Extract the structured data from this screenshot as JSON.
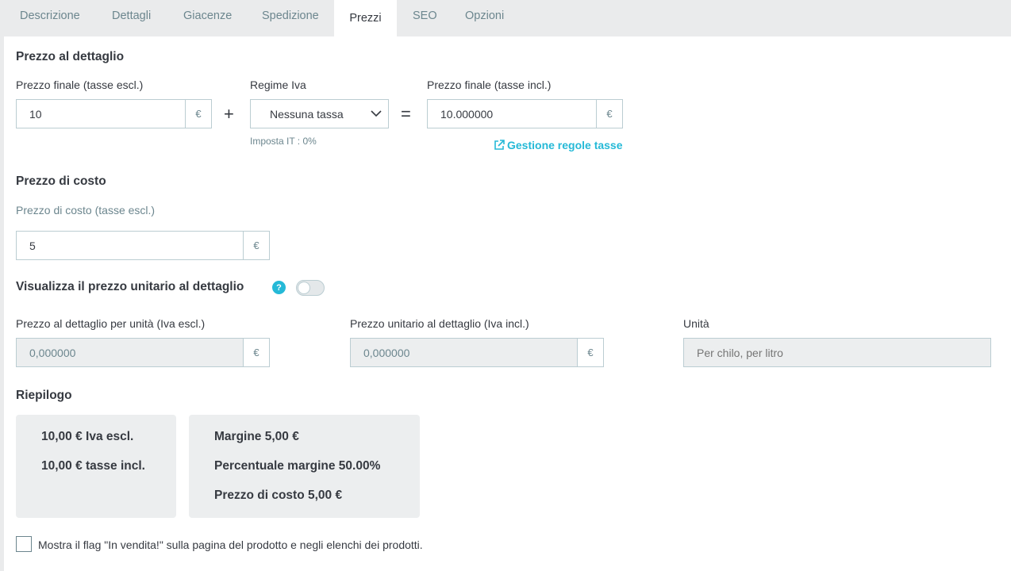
{
  "tabs": [
    "Descrizione",
    "Dettagli",
    "Giacenze",
    "Spedizione",
    "Prezzi",
    "SEO",
    "Opzioni"
  ],
  "active_tab": "Prezzi",
  "retail": {
    "title": "Prezzo al dettaglio",
    "price_excl_label": "Prezzo finale (tasse escl.)",
    "price_excl_value": "10",
    "currency": "€",
    "plus": "+",
    "tax_rule_label": "Regime Iva",
    "tax_rule_value": "Nessuna tassa",
    "tax_note": "Imposta IT : 0%",
    "equals": "=",
    "price_incl_label": "Prezzo finale (tasse incl.)",
    "price_incl_value": "10.000000",
    "manage_tax_link": "Gestione regole tasse"
  },
  "cost": {
    "title": "Prezzo di costo",
    "label": "Prezzo di costo (tasse escl.)",
    "value": "5",
    "currency": "€"
  },
  "unit_price": {
    "title": "Visualizza il prezzo unitario al dettaglio",
    "help": "?",
    "toggle_on": false,
    "excl_label": "Prezzo al dettaglio per unità (Iva escl.)",
    "excl_value": "0,000000",
    "incl_label": "Prezzo unitario al dettaglio (Iva incl.)",
    "incl_value": "0,000000",
    "currency": "€",
    "unit_label": "Unità",
    "unit_placeholder": "Per chilo, per litro"
  },
  "summary": {
    "title": "Riepilogo",
    "excl": "10,00 € Iva escl.",
    "incl": "10,00 € tasse incl.",
    "margin": "Margine 5,00 €",
    "margin_pct": "Percentuale margine 50.00%",
    "cost": "Prezzo di costo 5,00 €"
  },
  "on_sale": {
    "label": "Mostra il flag \"In vendita!\" sulla pagina del prodotto e negli elenchi dei prodotti.",
    "checked": false
  },
  "colors": {
    "accent": "#25b9d7",
    "border": "#bbcdd2",
    "muted": "#6c868e",
    "text": "#363a41"
  }
}
